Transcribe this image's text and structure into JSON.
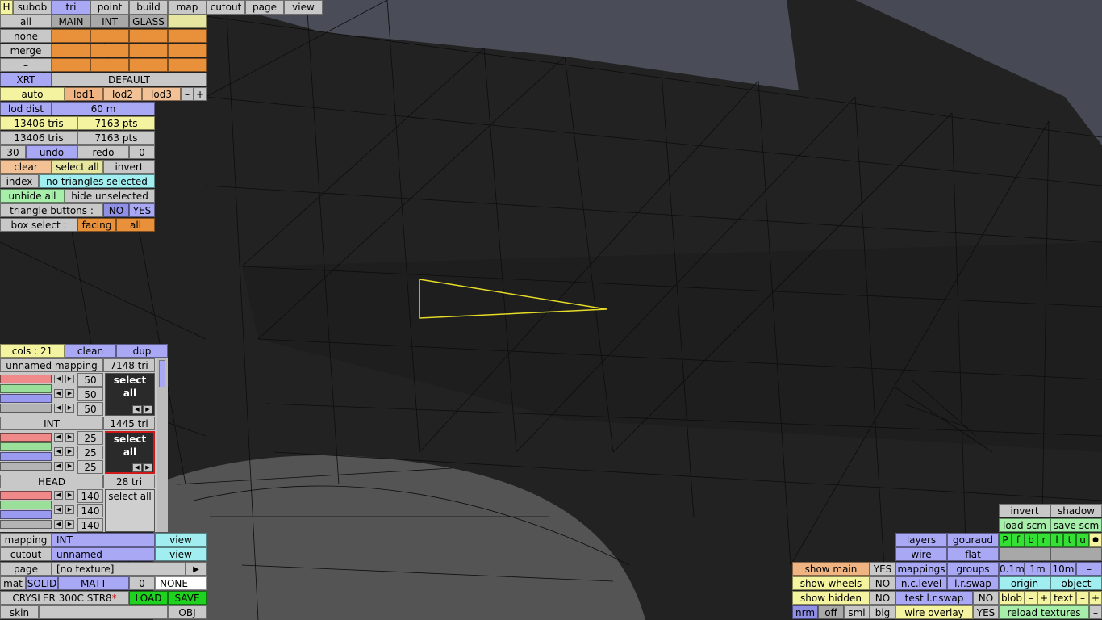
{
  "toolbar": {
    "h_label": "H",
    "tabs": [
      "subob",
      "tri",
      "point",
      "build",
      "map",
      "cutout",
      "page",
      "view"
    ],
    "active_tab": "tri"
  },
  "groups": {
    "all_label": "all",
    "none_label": "none",
    "merge_label": "merge",
    "dash_label": "–",
    "columns": [
      "MAIN",
      "INT",
      "GLASS"
    ]
  },
  "lod": {
    "xrt_label": "XRT",
    "default_label": "DEFAULT",
    "auto_label": "auto",
    "levels": [
      "lod1",
      "lod2",
      "lod3"
    ],
    "minus": "–",
    "plus": "+",
    "dist_label": "lod dist",
    "dist_value": "60 m"
  },
  "stats": {
    "tris_1": "13406 tris",
    "pts_1": "7163 pts",
    "tris_2": "13406 tris",
    "pts_2": "7163 pts"
  },
  "history": {
    "count": "30",
    "undo": "undo",
    "redo": "redo",
    "redo_count": "0"
  },
  "selection": {
    "clear": "clear",
    "select_all": "select all",
    "invert": "invert",
    "index_label": "index",
    "status": "no triangles selected",
    "unhide_all": "unhide all",
    "hide_unselected": "hide unselected",
    "triangle_buttons_label": "triangle buttons :",
    "no": "NO",
    "yes": "YES",
    "box_select_label": "box select :",
    "facing": "facing",
    "all": "all"
  },
  "colors": {
    "cols_label": "cols : 21",
    "clean": "clean",
    "dup": "dup",
    "groups": [
      {
        "name": "unnamed mapping",
        "tri": "7148 tri",
        "rgb": [
          "50",
          "50",
          "50"
        ],
        "select": "select all"
      },
      {
        "name": "INT",
        "tri": "1445 tri",
        "rgb": [
          "25",
          "25",
          "25"
        ],
        "select": "select all"
      },
      {
        "name": "HEAD",
        "tri": "28 tri",
        "rgb": [
          "140",
          "140",
          "140"
        ],
        "select": "select all"
      }
    ]
  },
  "bottom_left": {
    "mapping_label": "mapping",
    "mapping_value": "INT",
    "view1": "view",
    "cutout_label": "cutout",
    "cutout_value": "unnamed",
    "view2": "view",
    "page_label": "page",
    "page_value": "[no texture]",
    "page_arrow": "▶",
    "mat_label": "mat",
    "solid": "SOLID",
    "matt": "MATT",
    "mat_num": "0",
    "mat_none": "NONE",
    "car_name": "CRYSLER 300C STR8",
    "car_star": "*",
    "load": "LOAD",
    "save": "SAVE",
    "skin_label": "skin",
    "obj": "OBJ"
  },
  "bottom_right": {
    "invert": "invert",
    "shadow": "shadow",
    "load_scm": "load scm",
    "save_scm": "save scm",
    "layers": "layers",
    "gouraud": "gouraud",
    "pfbrltu": [
      "P",
      "f",
      "b",
      "r",
      "l",
      "t",
      "u"
    ],
    "dot": "●",
    "wire": "wire",
    "flat": "flat",
    "dash": "–",
    "show_main": "show main",
    "show_main_val": "YES",
    "mappings": "mappings",
    "groups": "groups",
    "sizes": [
      "0.1m",
      "1m",
      "10m"
    ],
    "size_minus": "–",
    "show_wheels": "show wheels",
    "show_wheels_val": "NO",
    "nc_level": "n.c.level",
    "lr_swap": "l.r.swap",
    "origin": "origin",
    "object": "object",
    "show_hidden": "show hidden",
    "show_hidden_val": "NO",
    "test_lr_swap": "test l.r.swap",
    "test_lr_swap_val": "NO",
    "blob": "blob",
    "text": "text",
    "minus": "–",
    "plus": "+",
    "nrm": "nrm",
    "off": "off",
    "sml": "sml",
    "big": "big",
    "wire_overlay": "wire overlay",
    "wire_overlay_val": "YES",
    "reload_textures": "reload textures",
    "reload_minus": "–"
  },
  "style": {
    "selection_outline": "#e6dc28",
    "background": "#222222"
  }
}
